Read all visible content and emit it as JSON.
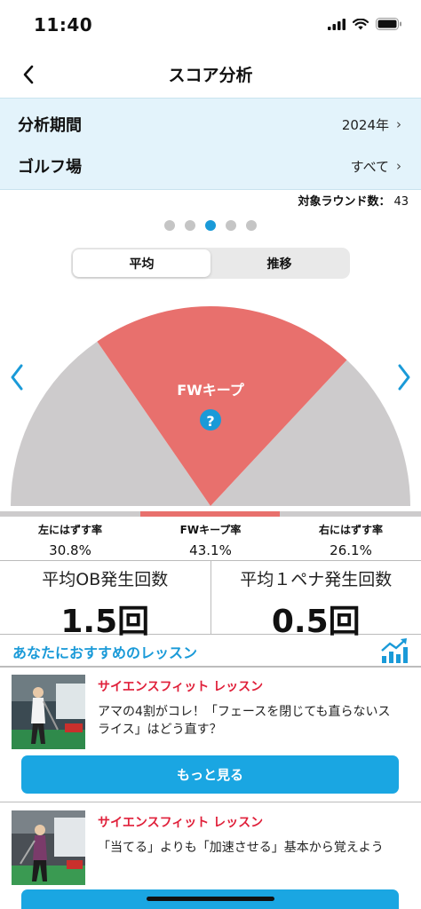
{
  "status_bar": {
    "time": "11:40"
  },
  "nav": {
    "title": "スコア分析"
  },
  "filters": [
    {
      "label": "分析期間",
      "value": "2024年"
    },
    {
      "label": "ゴルフ場",
      "value": "すべて"
    }
  ],
  "round_count": {
    "label": "対象ラウンド数：",
    "value": "43"
  },
  "pager": {
    "count": 5,
    "active_index": 2
  },
  "segment": {
    "average": "平均",
    "trend": "推移"
  },
  "gauge": {
    "center_label": "FWキープ",
    "help_glyph": "?",
    "colors": {
      "fw_keep": "#e8706d",
      "miss": "#cdcbcc",
      "accent": "#1a9ad8"
    }
  },
  "stats": [
    {
      "label": "左にはずす率",
      "value": "30.8%",
      "fraction": 0.308
    },
    {
      "label": "FWキープ率",
      "value": "43.1%",
      "fraction": 0.431
    },
    {
      "label": "右にはずす率",
      "value": "26.1%",
      "fraction": 0.261
    }
  ],
  "averages": [
    {
      "label": "平均OB発生回数",
      "value": "1.5回"
    },
    {
      "label": "平均１ペナ発生回数",
      "value": "0.5回"
    }
  ],
  "lessons_section": {
    "title": "あなたにおすすめのレッスン"
  },
  "lessons": [
    {
      "brand": "サイエンスフィット レッスン",
      "text": "アマの4割がコレ！「フェースを閉じても直らないスライス」はどう直す？",
      "button": "もっと見る"
    },
    {
      "brand": "サイエンスフィット レッスン",
      "text": "「当てる」よりも「加速させる」基本から覚えよう"
    }
  ]
}
